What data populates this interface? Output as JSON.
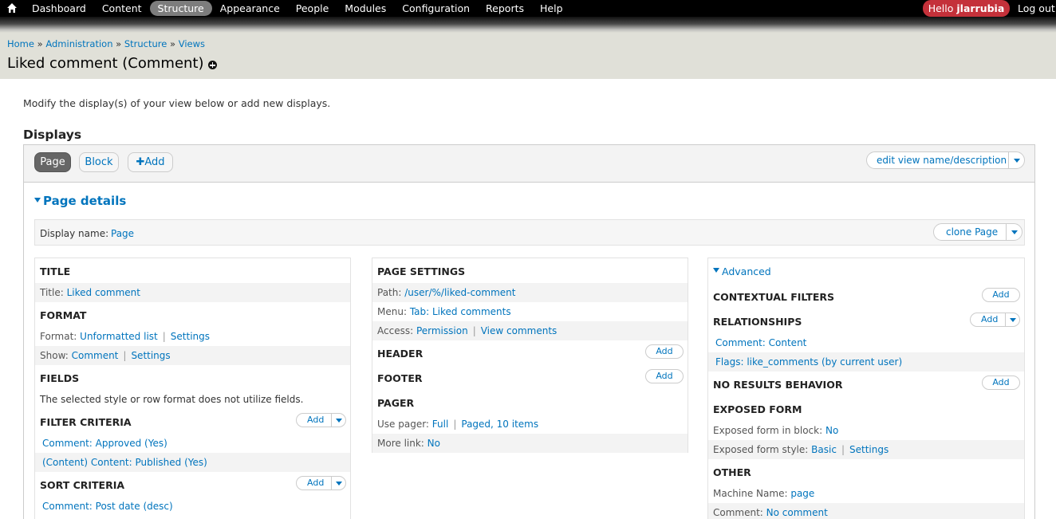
{
  "toolbar": {
    "home_icon": "home-icon",
    "items": [
      "Dashboard",
      "Content",
      "Structure",
      "Appearance",
      "People",
      "Modules",
      "Configuration",
      "Reports",
      "Help"
    ],
    "active": "Structure",
    "hello": "Hello",
    "username": "jlarrubia",
    "logout": "Log out"
  },
  "breadcrumb": [
    "Home",
    "Administration",
    "Structure",
    "Views"
  ],
  "page_title": "Liked comment (Comment)",
  "description": "Modify the display(s) of your view below or add new displays.",
  "displays_heading": "Displays",
  "tabs": {
    "page": "Page",
    "block": "Block",
    "add": "Add"
  },
  "edit_view_button": "edit view name/description",
  "page_details": "Page details",
  "display_name": {
    "label": "Display name:",
    "value": "Page"
  },
  "clone_button": "clone Page",
  "col1": {
    "title": {
      "heading": "Title",
      "label": "Title:",
      "value": "Liked comment"
    },
    "format": {
      "heading": "Format",
      "format_label": "Format:",
      "format_value": "Unformatted list",
      "format_settings": "Settings",
      "show_label": "Show:",
      "show_value": "Comment",
      "show_settings": "Settings"
    },
    "fields": {
      "heading": "Fields",
      "text": "The selected style or row format does not utilize fields."
    },
    "filter": {
      "heading": "Filter criteria",
      "add": "Add",
      "items": [
        "Comment: Approved (Yes)",
        "(Content) Content: Published (Yes)"
      ]
    },
    "sort": {
      "heading": "Sort criteria",
      "add": "Add",
      "items": [
        "Comment: Post date (desc)"
      ]
    }
  },
  "col2": {
    "page_settings": {
      "heading": "Page settings",
      "path_label": "Path:",
      "path_value": "/user/%/liked-comment",
      "menu_label": "Menu:",
      "menu_value": "Tab: Liked comments",
      "access_label": "Access:",
      "access_value": "Permission",
      "access_extra": "View comments"
    },
    "header": {
      "heading": "Header",
      "add": "Add"
    },
    "footer": {
      "heading": "Footer",
      "add": "Add"
    },
    "pager": {
      "heading": "Pager",
      "use_label": "Use pager:",
      "use_value": "Full",
      "use_extra": "Paged, 10 items",
      "more_label": "More link:",
      "more_value": "No"
    }
  },
  "col3": {
    "advanced": "Advanced",
    "contextual": {
      "heading": "Contextual filters",
      "add": "Add"
    },
    "relationships": {
      "heading": "Relationships",
      "add": "Add",
      "items": [
        "Comment: Content",
        "Flags: like_comments (by current user)"
      ]
    },
    "no_results": {
      "heading": "No results behavior",
      "add": "Add"
    },
    "exposed": {
      "heading": "Exposed form",
      "block_label": "Exposed form in block:",
      "block_value": "No",
      "style_label": "Exposed form style:",
      "style_value": "Basic",
      "style_settings": "Settings"
    },
    "other": {
      "heading": "Other",
      "machine_label": "Machine Name:",
      "machine_value": "page",
      "comment_label": "Comment:",
      "comment_value": "No comment"
    }
  }
}
